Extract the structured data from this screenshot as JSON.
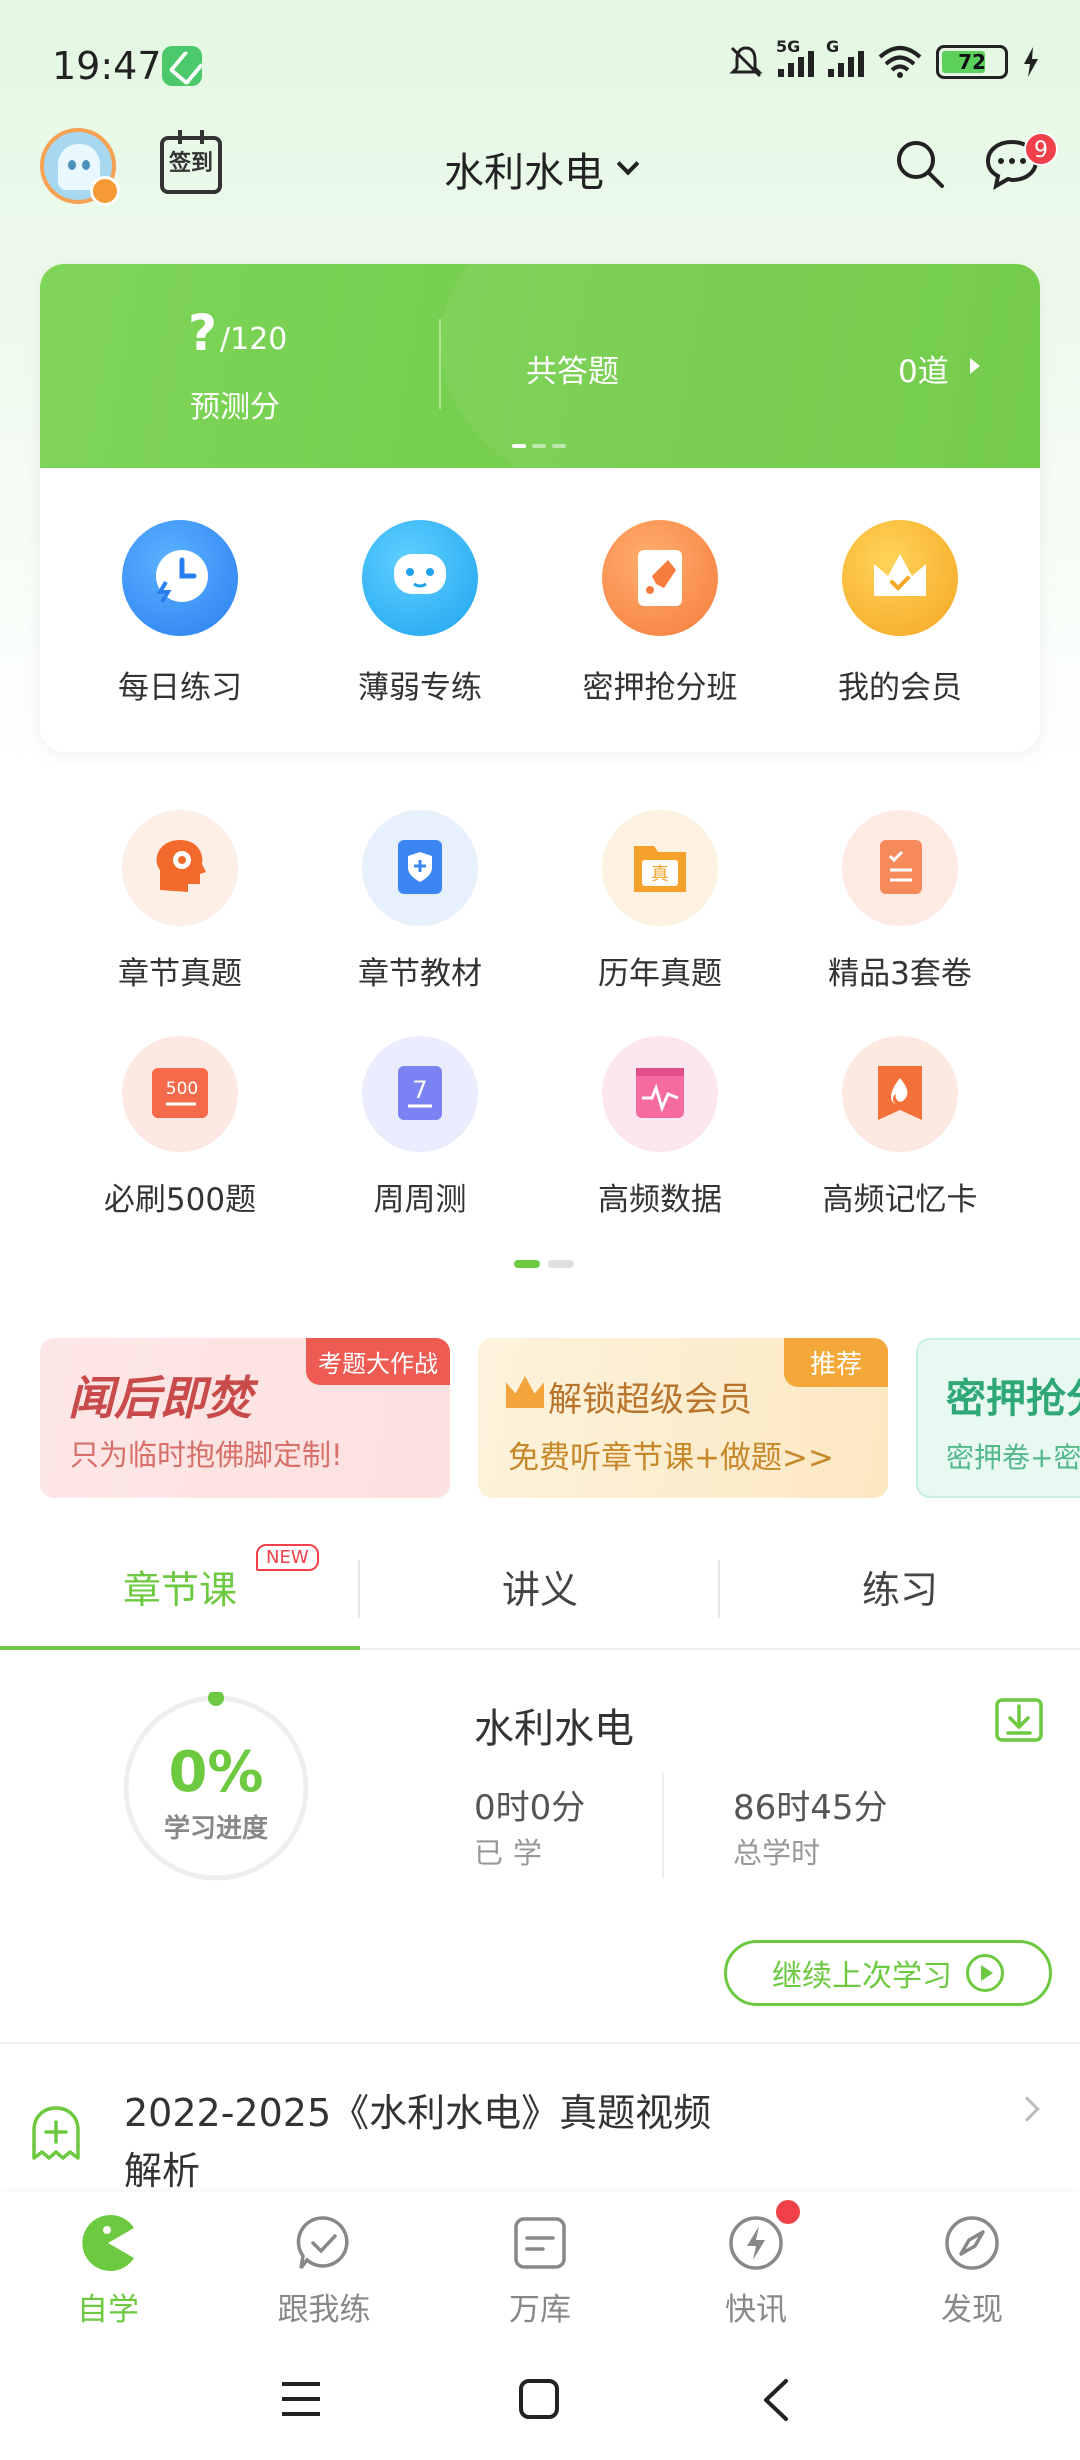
{
  "status": {
    "time": "19:47",
    "battery": "72",
    "net1": "5G",
    "net2": "G"
  },
  "header": {
    "checkin": "签到",
    "title": "水利水电",
    "msg_count": "9"
  },
  "card": {
    "score": "?",
    "score_max": "/120",
    "score_label": "预测分",
    "answered_label": "共答题",
    "answered_count": "0道",
    "items": [
      {
        "label": "每日练习"
      },
      {
        "label": "薄弱专练"
      },
      {
        "label": "密押抢分班"
      },
      {
        "label": "我的会员"
      }
    ]
  },
  "grid": {
    "row1": [
      {
        "label": "章节真题"
      },
      {
        "label": "章节教材"
      },
      {
        "label": "历年真题"
      },
      {
        "label": "精品3套卷"
      }
    ],
    "row2": [
      {
        "label": "必刷500题"
      },
      {
        "label": "周周测"
      },
      {
        "label": "高频数据"
      },
      {
        "label": "高频记忆卡"
      }
    ]
  },
  "banners": {
    "b1": {
      "title": "闻后即焚",
      "sub": "只为临时抱佛脚定制!",
      "tag": "考题大作战"
    },
    "b2": {
      "title": "解锁超级会员",
      "sub": "免费听章节课+做题>>",
      "tag": "推荐"
    },
    "b3": {
      "title": "密押抢分",
      "sub": "密押卷+密"
    }
  },
  "tabs": {
    "t1": "章节课",
    "new": "NEW",
    "t2": "讲义",
    "t3": "练习"
  },
  "progress": {
    "pct": "0%",
    "label": "学习进度",
    "value": 0,
    "course": "水利水电",
    "studied_val": "0时0分",
    "studied_lab": "已学",
    "total_val": "86时45分",
    "total_lab": "总学时",
    "continue": "继续上次学习"
  },
  "list": {
    "title": "2022-2025《水利水电》真题视频解析"
  },
  "nav": {
    "items": [
      {
        "label": "自学"
      },
      {
        "label": "跟我练"
      },
      {
        "label": "万库"
      },
      {
        "label": "快讯"
      },
      {
        "label": "发现"
      }
    ]
  },
  "colors": {
    "accent": "#6cc940",
    "badge": "#f2404a"
  }
}
